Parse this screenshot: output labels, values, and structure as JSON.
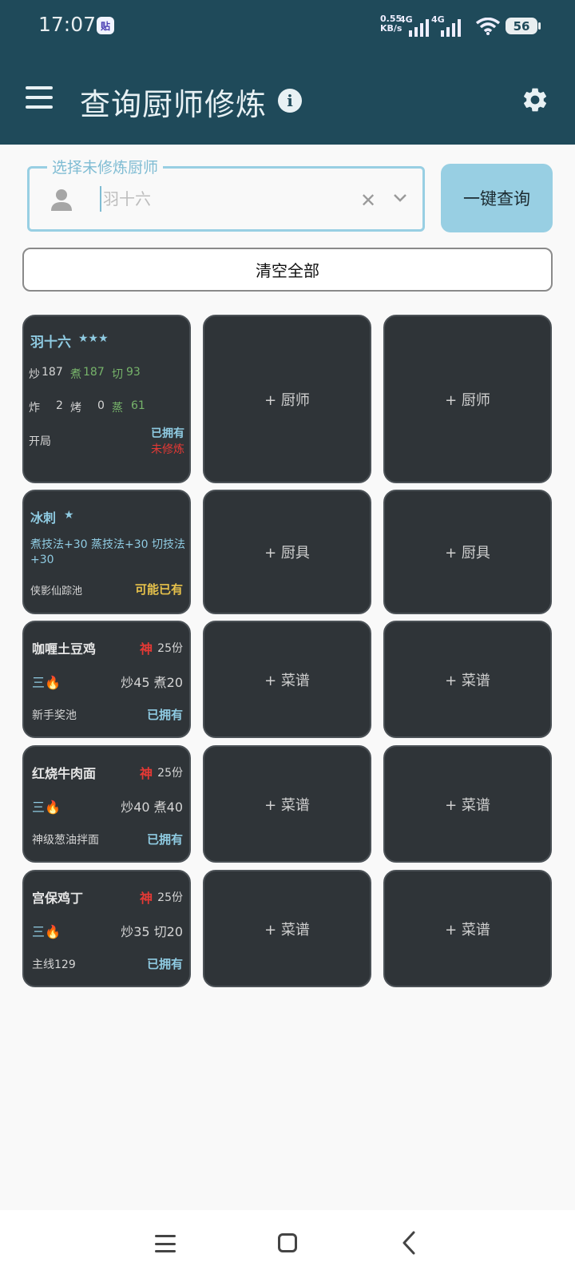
{
  "status_bar": {
    "time": "17:07",
    "app_badge": "贴",
    "net_speed_value": "0.55",
    "net_speed_unit": "KB/s",
    "sim1": "4G",
    "sim2": "4G",
    "battery": "56"
  },
  "header": {
    "title": "查询厨师修炼",
    "menu_icon": "menu-icon",
    "info_icon": "info-icon",
    "settings_icon": "gear-icon"
  },
  "search": {
    "label": "选择未修炼厨师",
    "placeholder": "羽十六",
    "value": "",
    "clear_symbol": "✕",
    "query_button": "一键查询"
  },
  "clear_all_button": "清空全部",
  "chef_card": {
    "name": "羽十六",
    "stars": "★★★",
    "stat_row1": [
      {
        "label": "炒",
        "value": "187",
        "color": "normal"
      },
      {
        "label": "煮",
        "value": "187",
        "color": "green"
      },
      {
        "label": "切",
        "value": " 93",
        "color": "green"
      }
    ],
    "stat_row2": [
      {
        "label": "炸",
        "value": "2",
        "color": "normal"
      },
      {
        "label": "烤",
        "value": "0",
        "color": "normal"
      },
      {
        "label": "蒸",
        "value": "61",
        "color": "green"
      }
    ],
    "source": "开局",
    "owned": "已拥有",
    "not_trained": "未修炼"
  },
  "equip_card": {
    "name": "冰刺",
    "stars": "★",
    "effect": "煮技法+30 蒸技法+30 切技法+30",
    "source": "侠影仙踪池",
    "status": "可能已有"
  },
  "recipe_cards": [
    {
      "name": "咖喱土豆鸡",
      "rank": "神",
      "portions": "25份",
      "heat": "三🔥",
      "skills": "炒45 煮20",
      "source": "新手奖池",
      "status": "已拥有"
    },
    {
      "name": "红烧牛肉面",
      "rank": "神",
      "portions": "25份",
      "heat": "三🔥",
      "skills": "炒40 煮40",
      "source": "神级葱油拌面",
      "status": "已拥有"
    },
    {
      "name": "宫保鸡丁",
      "rank": "神",
      "portions": "25份",
      "heat": "三🔥",
      "skills": "炒35 切20",
      "source": "主线129",
      "status": "已拥有"
    }
  ],
  "empty_slots": {
    "chef": "+ 厨师",
    "equipment": "+ 厨具",
    "recipe": "+ 菜谱"
  },
  "colors": {
    "appbar": "#1f4a5a",
    "accent": "#98cfe3",
    "card_bg": "#2f3438",
    "god_red": "#e53935",
    "maybe_yellow": "#e6c14b",
    "skill_green": "#76b36a"
  },
  "nav": {
    "recents_icon": "recents-icon",
    "home_icon": "home-icon",
    "back_icon": "back-icon"
  }
}
